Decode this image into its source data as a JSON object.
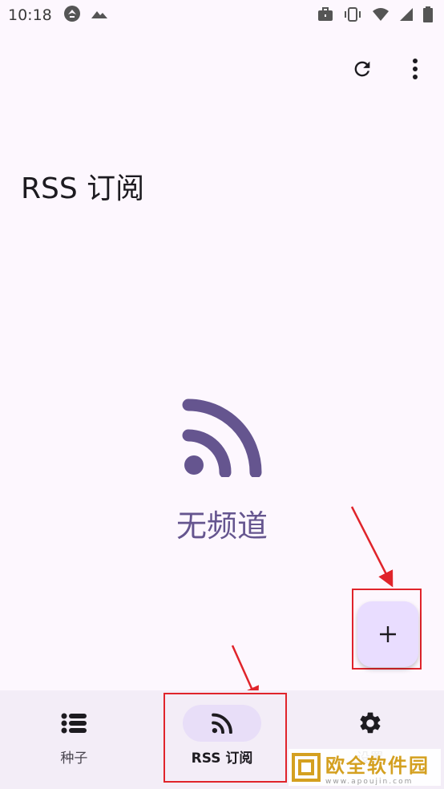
{
  "status_bar": {
    "time": "10:18"
  },
  "page": {
    "title": "RSS 订阅"
  },
  "empty_state": {
    "text": "无频道"
  },
  "fab": {
    "label": "+"
  },
  "bottom_nav": {
    "items": [
      {
        "label": "种子",
        "icon": "list-icon",
        "active": false
      },
      {
        "label": "RSS 订阅",
        "icon": "rss-icon",
        "active": true
      },
      {
        "label": "设置",
        "icon": "gear-icon",
        "active": false
      }
    ]
  },
  "watermark": {
    "title": "欧全软件园",
    "url": "www.apoujin.com"
  },
  "colors": {
    "accent": "#65558f",
    "fab": "#e9ddff",
    "nav_active": "#e8def8",
    "annotation": "#e0242b"
  }
}
